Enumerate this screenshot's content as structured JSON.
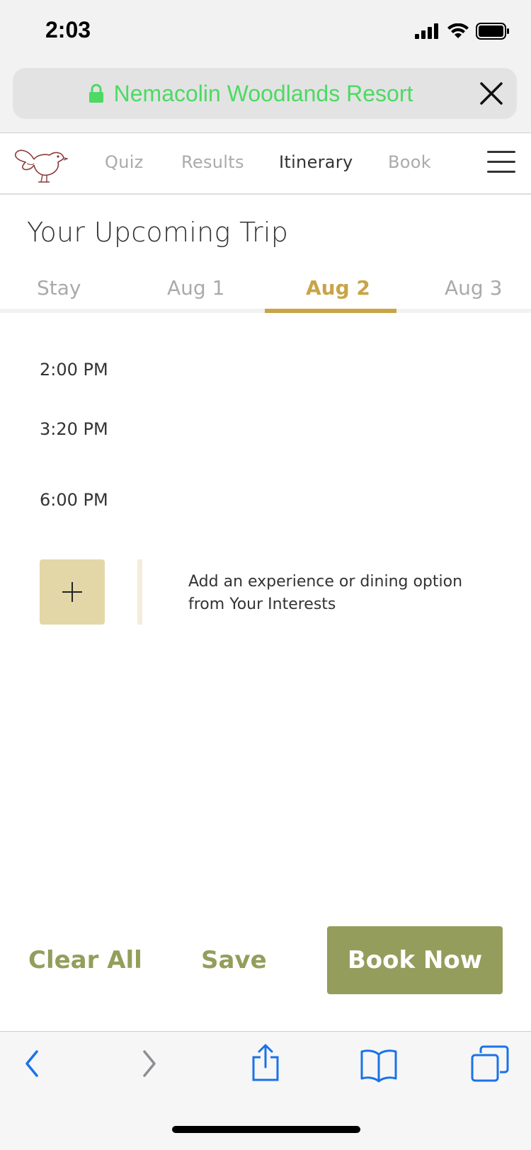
{
  "status": {
    "time": "2:03"
  },
  "browser": {
    "site_title": "Nemacolin Woodlands Resort"
  },
  "nav": {
    "items": [
      "Quiz",
      "Results",
      "Itinerary",
      "Book"
    ],
    "active": "Itinerary"
  },
  "page": {
    "title": "Your Upcoming Trip"
  },
  "day_tabs": {
    "items": [
      "Stay",
      "Aug 1",
      "Aug 2",
      "Aug 3"
    ],
    "active": "Aug 2"
  },
  "schedule": {
    "times": [
      "2:00 PM",
      "3:20 PM",
      "6:00 PM"
    ]
  },
  "add_experience": {
    "text": "Add an experience or dining option from Your Interests"
  },
  "actions": {
    "clear_label": "Clear All",
    "save_label": "Save",
    "book_label": "Book Now"
  },
  "colors": {
    "accent_gold": "#c9a447",
    "olive": "#959d5c",
    "add_bg": "#e3d7a8",
    "url_green": "#4cd964",
    "ios_blue": "#1a73e8"
  }
}
